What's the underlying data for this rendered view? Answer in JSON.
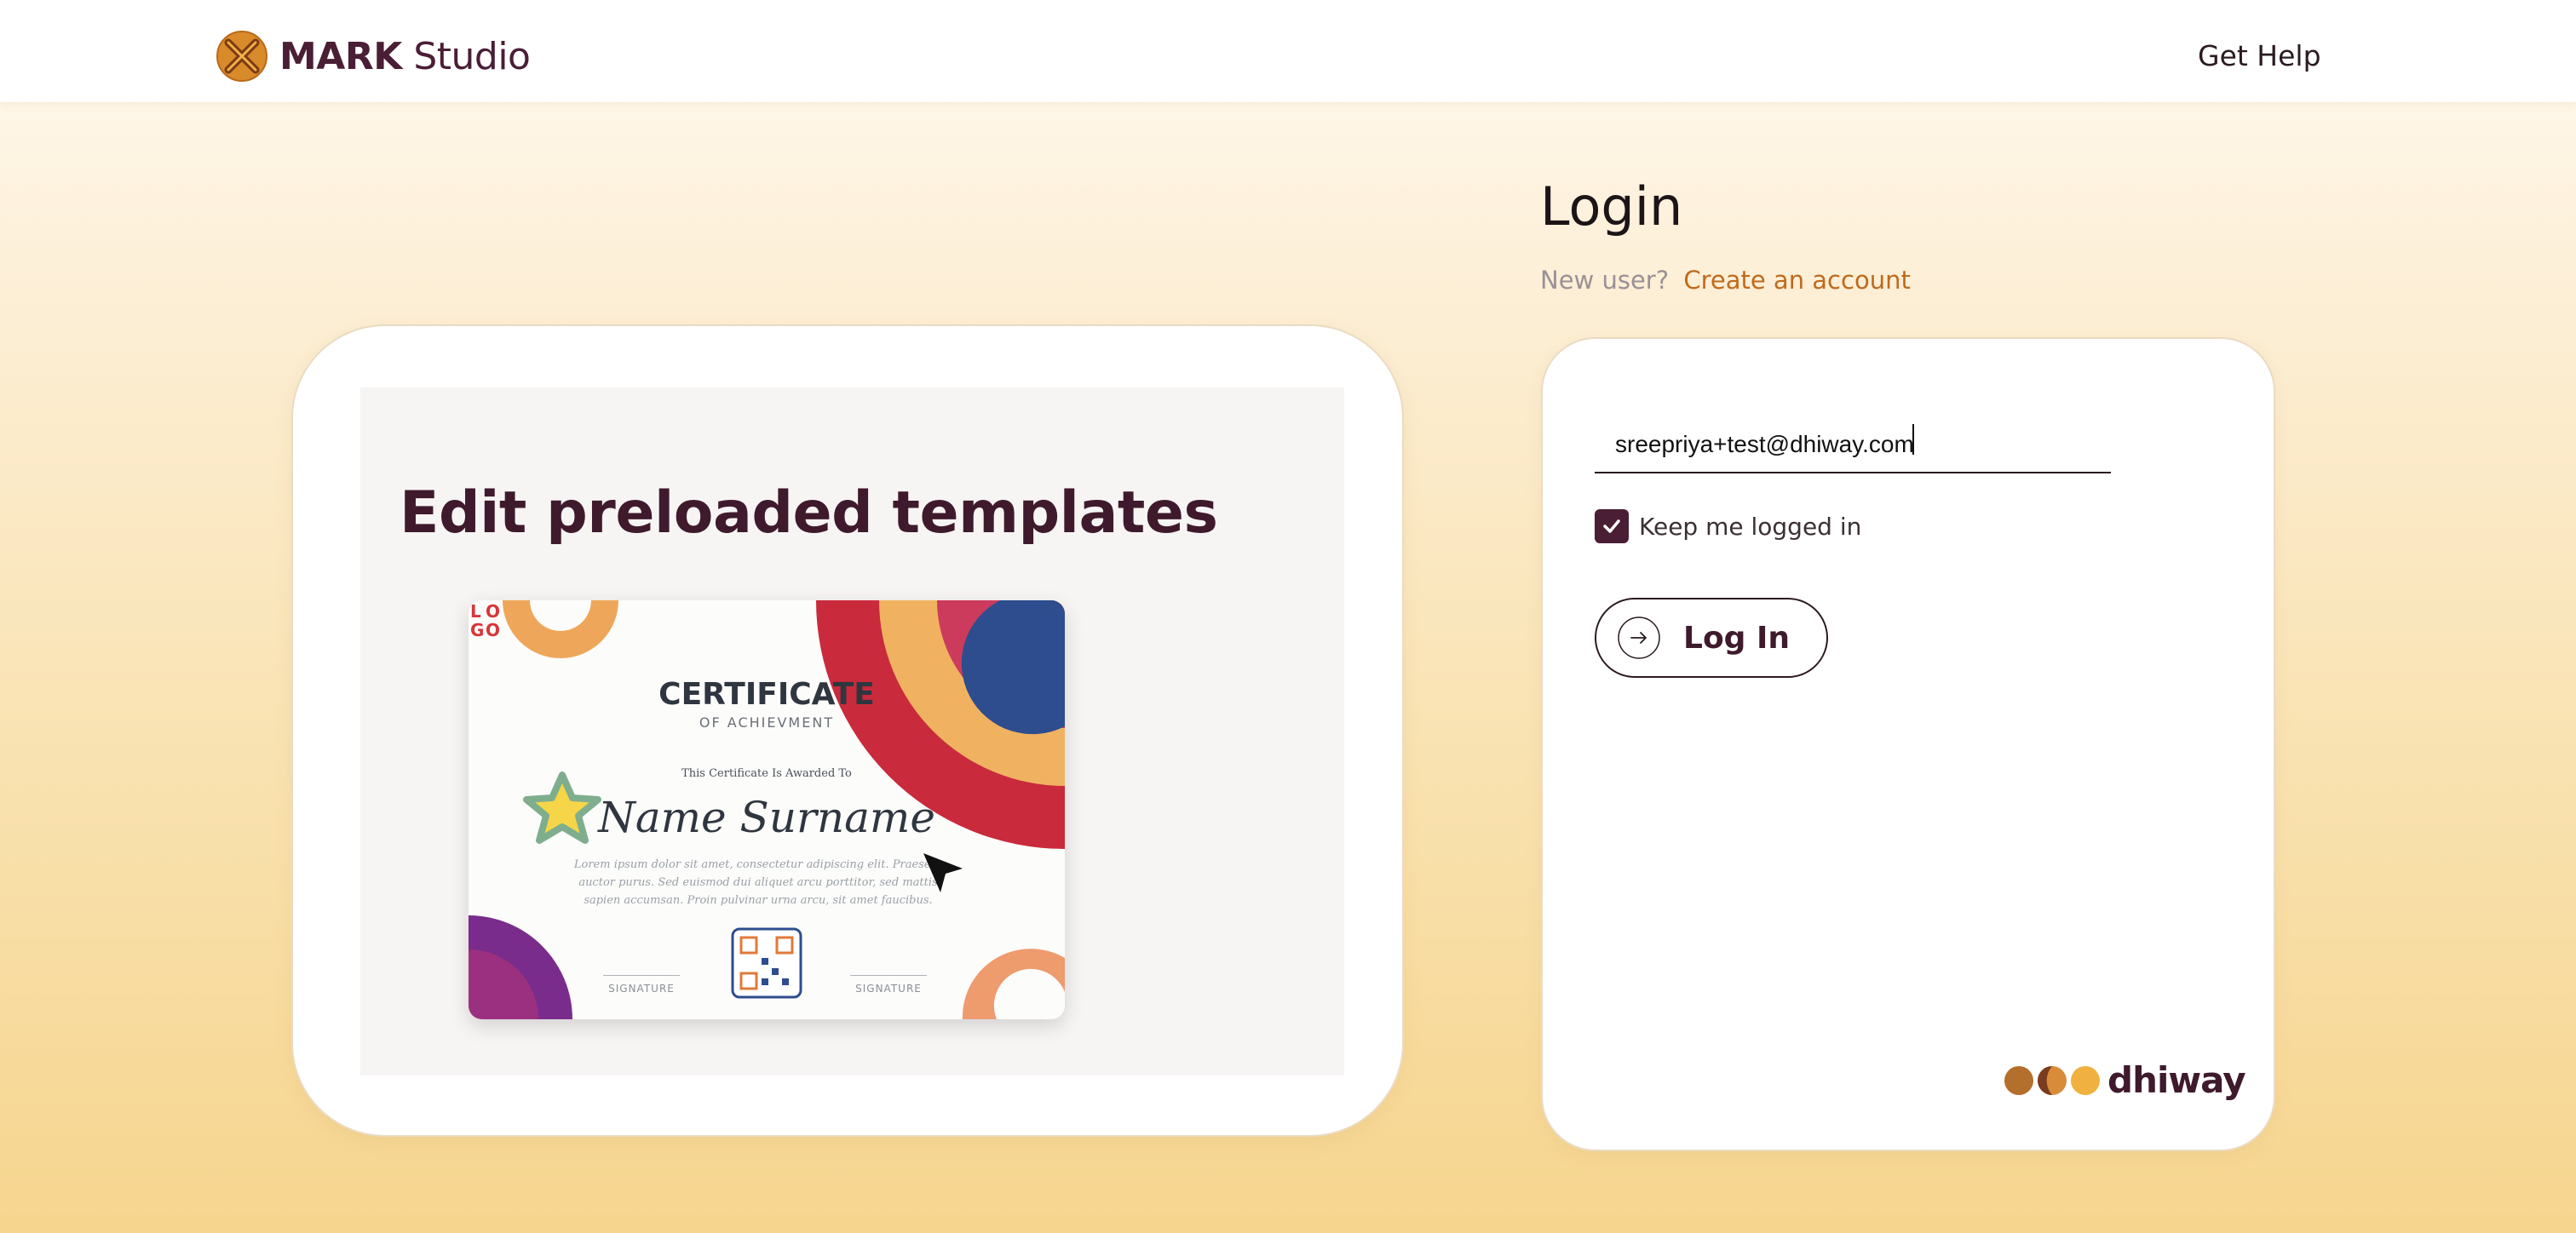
{
  "header": {
    "brand_bold": "MARK",
    "brand_rest": " Studio",
    "get_help": "Get Help"
  },
  "promo": {
    "title": "Edit preloaded templates",
    "certificate": {
      "logo_text": "LOGO",
      "title": "CERTIFICATE",
      "subtitle": "OF ACHIEVMENT",
      "awarded_to": "This Certificate Is Awarded To",
      "name": "Name Surname",
      "body": "Lorem ipsum dolor sit amet, consectetur adipiscing elit. Praesent auctor purus. Sed euismod dui aliquet arcu porttitor, sed mattis sapien accumsan. Proin pulvinar urna arcu, sit amet faucibus.",
      "signature_left": "SIGNATURE",
      "signature_right": "SIGNATURE"
    }
  },
  "login": {
    "title": "Login",
    "new_user_prompt": "New user?",
    "create_account": "Create an account",
    "email_value": "sreepriya+test@dhiway.com",
    "keep_logged_in": "Keep me logged in",
    "keep_logged_in_checked": true,
    "submit_label": "Log In",
    "footer_brand": "dhiway"
  },
  "colors": {
    "brand_dark": "#4a1e35",
    "link_orange": "#c06a1c",
    "page_gradient_top": "#fffaf1",
    "page_gradient_bottom": "#f6d58e"
  },
  "icons": {
    "brand": "mark-studio-logo-icon",
    "checkbox": "checkmark-icon",
    "login": "arrow-right-circle-icon",
    "cursor": "mouse-pointer-icon"
  }
}
